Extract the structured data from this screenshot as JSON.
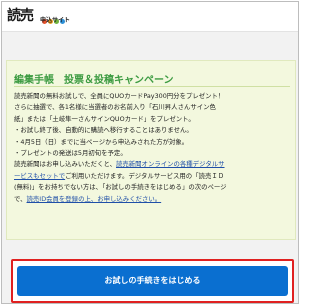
{
  "header": {
    "logo_main": "読売",
    "logo_sub": "申込サイト",
    "dot_colors": [
      "#e8502b",
      "#f0a11f",
      "#6fb23a",
      "#2c8fd6"
    ]
  },
  "card": {
    "title": "編集手帳　投票＆投稿キャンペーン",
    "lines": [
      "読売新聞の無料お試しで、全員にQUOカードPay300円分をプレゼント！",
      "さらに抽選で、各1名様に当選者のお名前入り「石川昇人さんサイン色",
      "紙」または「土岐隼一さんサインQUOカード」をプレゼント。",
      "・お試し終了後、自動的に購読へ移行することはありません。",
      "・4月5日（日）までに当ページから申込みされた方が対象。",
      "・プレゼントの発送は5月初旬を予定。"
    ],
    "line7_prefix": "読売新聞はお申し込みいただくと、",
    "line7_link": "読売新聞オンラインの各種デジタルサ",
    "line8_link": "ービスもセットで",
    "line8_rest": "ご利用いただけます。デジタルサービス用の「読売ＩＤ",
    "line9": "(無料)」をお持ちでない方は、「お試しの手続きをはじめる」の次のページ",
    "line10_prefix": "で、",
    "line10_link": "読売ID会員を登録の上、お申し込みください。"
  },
  "cta": {
    "label": "お試しの手続きをはじめる"
  }
}
